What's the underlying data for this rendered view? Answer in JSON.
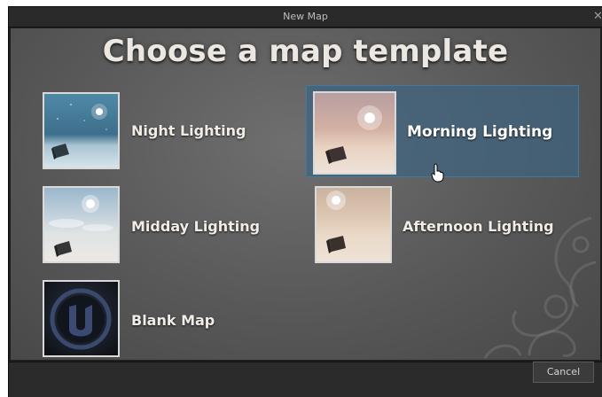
{
  "window": {
    "title": "New Map",
    "close_icon": "close-icon"
  },
  "heading": "Choose a map template",
  "templates": [
    {
      "id": "night",
      "label": "Night Lighting",
      "icon": "night-lighting-thumbnail"
    },
    {
      "id": "morning",
      "label": "Morning Lighting",
      "icon": "morning-lighting-thumbnail",
      "selected": true
    },
    {
      "id": "midday",
      "label": "Midday Lighting",
      "icon": "midday-lighting-thumbnail"
    },
    {
      "id": "afternoon",
      "label": "Afternoon Lighting",
      "icon": "afternoon-lighting-thumbnail"
    },
    {
      "id": "blank",
      "label": "Blank Map",
      "icon": "unreal-logo-thumbnail"
    }
  ],
  "footer": {
    "cancel_label": "Cancel"
  },
  "colors": {
    "selection": "#3e6480",
    "selection_border": "#3f7aa0",
    "label": "#f1ece6"
  }
}
